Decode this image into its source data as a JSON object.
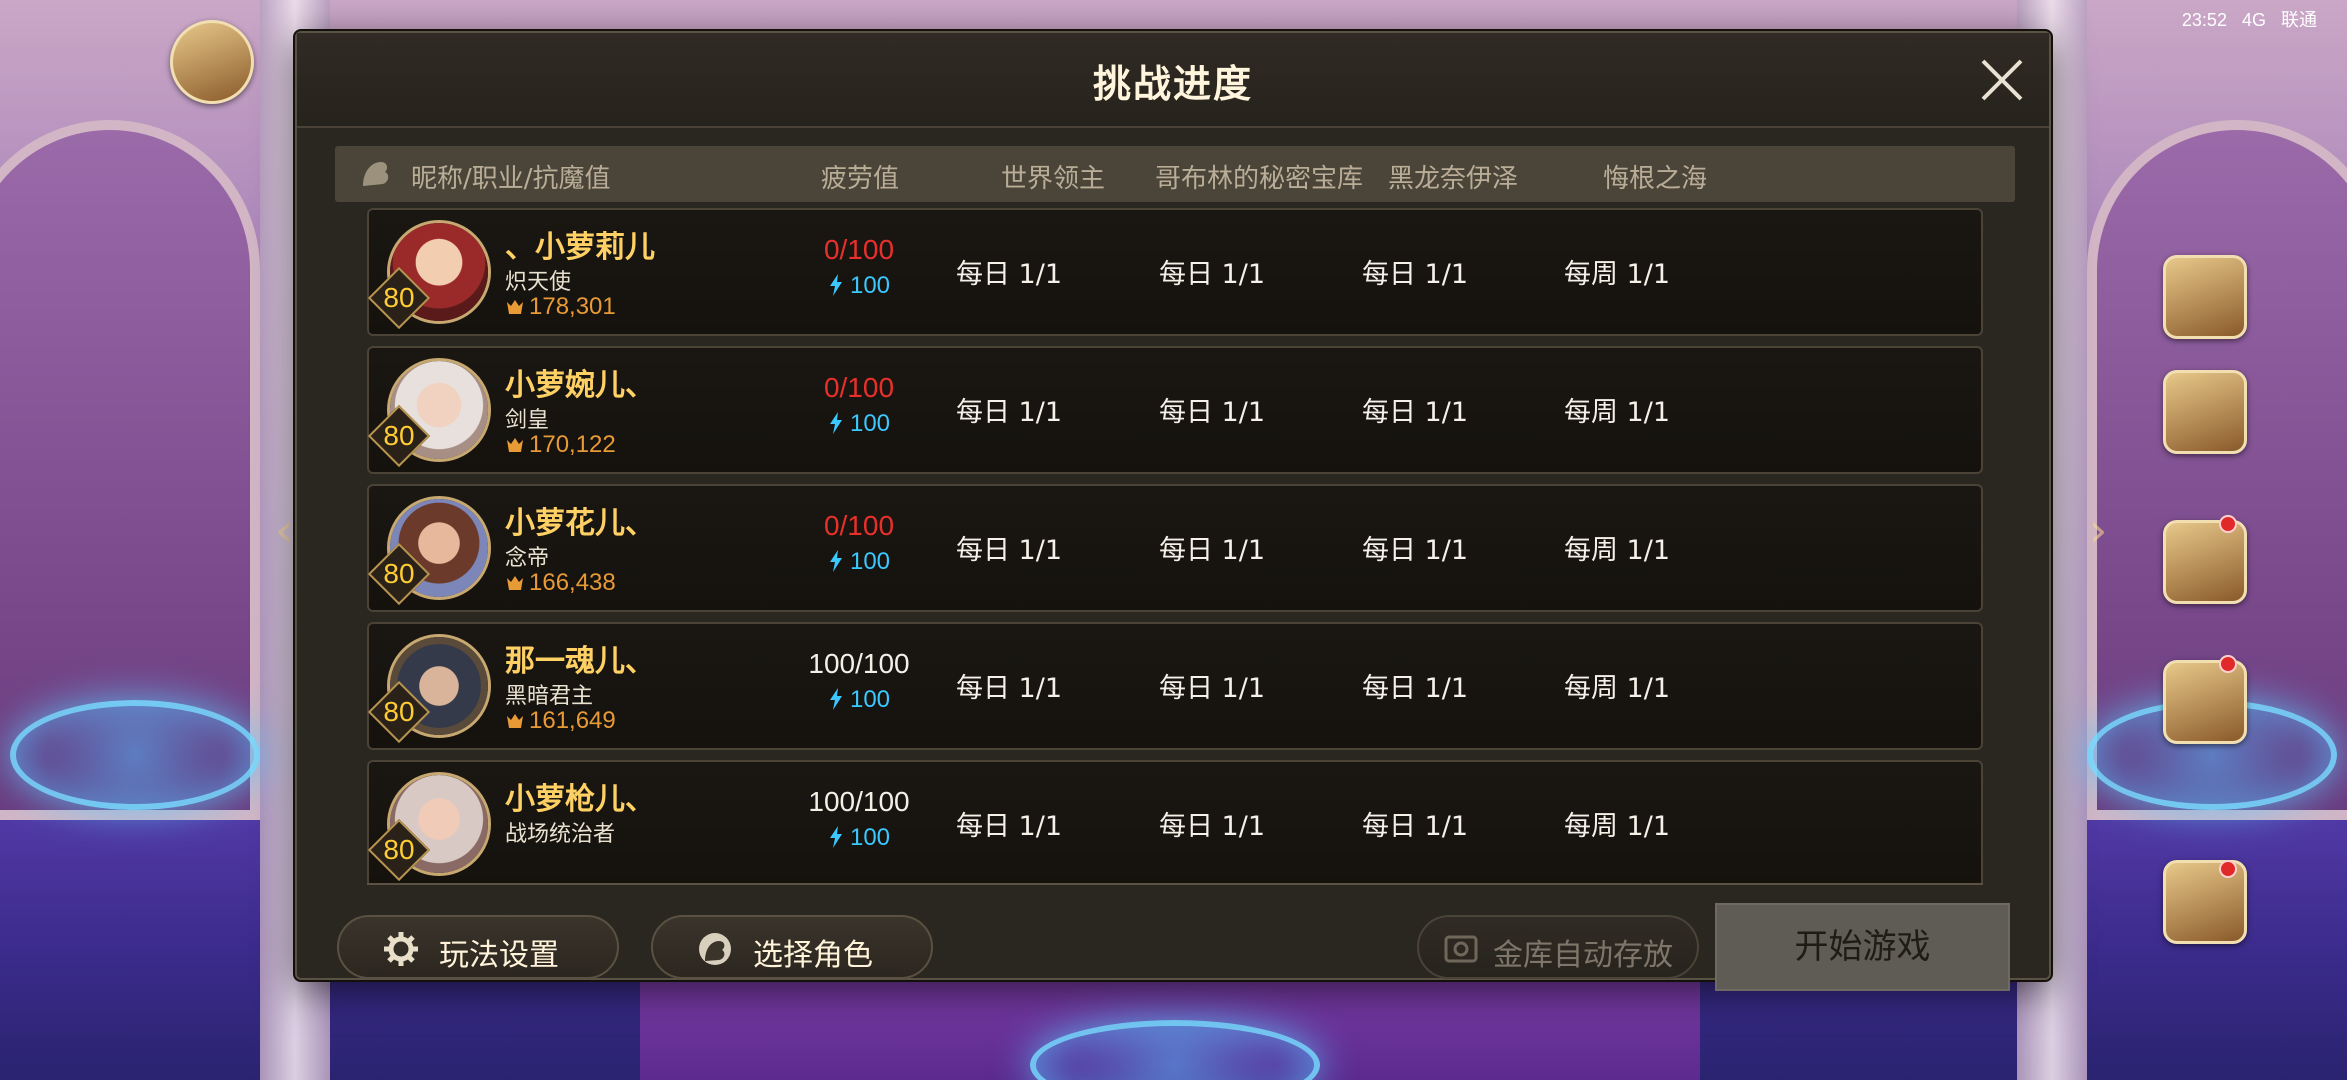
{
  "status_bar": {
    "time": "23:52",
    "network": "4G",
    "carrier": "联通"
  },
  "dialog": {
    "title": "挑战进度",
    "headers": {
      "name_col": "昵称/职业/抗魔值",
      "fatigue": "疲劳值",
      "world_boss": "世界领主",
      "goblin": "哥布林的秘密宝库",
      "black_dragon": "黑龙奈伊泽",
      "regret_sea": "悔根之海"
    },
    "rows": [
      {
        "level": "80",
        "name": "、小萝莉儿",
        "job": "炽天使",
        "power": "178,301",
        "fatigue": "0/100",
        "fatigue_state": "red",
        "energy": "100",
        "world_boss": "每日 1/1",
        "goblin": "每日 1/1",
        "black_dragon": "每日 1/1",
        "regret_sea": "每周 1/1"
      },
      {
        "level": "80",
        "name": "小萝婉儿、",
        "job": "剑皇",
        "power": "170,122",
        "fatigue": "0/100",
        "fatigue_state": "red",
        "energy": "100",
        "world_boss": "每日 1/1",
        "goblin": "每日 1/1",
        "black_dragon": "每日 1/1",
        "regret_sea": "每周 1/1"
      },
      {
        "level": "80",
        "name": "小萝花儿、",
        "job": "念帝",
        "power": "166,438",
        "fatigue": "0/100",
        "fatigue_state": "red",
        "energy": "100",
        "world_boss": "每日 1/1",
        "goblin": "每日 1/1",
        "black_dragon": "每日 1/1",
        "regret_sea": "每周 1/1"
      },
      {
        "level": "80",
        "name": "那一魂儿、",
        "job": "黑暗君主",
        "power": "161,649",
        "fatigue": "100/100",
        "fatigue_state": "white",
        "energy": "100",
        "world_boss": "每日 1/1",
        "goblin": "每日 1/1",
        "black_dragon": "每日 1/1",
        "regret_sea": "每周 1/1"
      },
      {
        "level": "80",
        "name": "小萝枪儿、",
        "job": "战场统治者",
        "power": "",
        "fatigue": "100/100",
        "fatigue_state": "white",
        "energy": "100",
        "world_boss": "每日 1/1",
        "goblin": "每日 1/1",
        "black_dragon": "每日 1/1",
        "regret_sea": "每周 1/1"
      }
    ],
    "buttons": {
      "settings": "玩法设置",
      "select_role": "选择角色",
      "auto_store": "金库自动存放",
      "start": "开始游戏"
    }
  },
  "colors": {
    "panel": "#2a2620",
    "name": "#ffd064",
    "fatigue_red": "#e8302a",
    "energy": "#3bc8ff",
    "power": "#e79a35"
  }
}
